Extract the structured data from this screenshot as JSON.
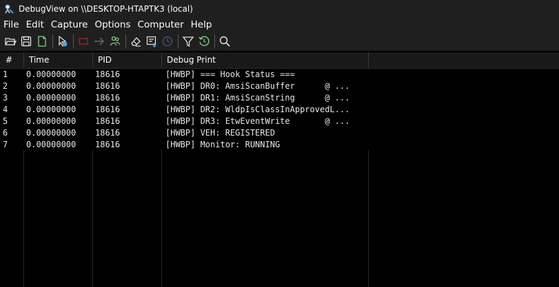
{
  "window": {
    "title": "DebugView on \\\\DESKTOP-HTAPTK3 (local)"
  },
  "menu": [
    "File",
    "Edit",
    "Capture",
    "Options",
    "Computer",
    "Help"
  ],
  "toolbar": {
    "icons": [
      "open-icon",
      "save-icon",
      "new-log-icon",
      "capture-icon",
      "stop-icon",
      "forward-icon",
      "connect-icon",
      "clear-icon",
      "autoscroll-icon",
      "time-icon",
      "filter-icon",
      "history-icon",
      "find-icon"
    ]
  },
  "columns": {
    "num": "#",
    "time": "Time",
    "pid": "PID",
    "debug": "Debug Print"
  },
  "rows": [
    {
      "num": "1",
      "time": "0.00000000",
      "pid": "18616",
      "text": "[HWBP] === Hook Status ==="
    },
    {
      "num": "2",
      "time": "0.00000000",
      "pid": "18616",
      "text": "[HWBP] DR0: AmsiScanBuffer      @ ..."
    },
    {
      "num": "3",
      "time": "0.00000000",
      "pid": "18616",
      "text": "[HWBP] DR1: AmsiScanString      @ ..."
    },
    {
      "num": "4",
      "time": "0.00000000",
      "pid": "18616",
      "text": "[HWBP] DR2: WldpIsClassInApprovedL..."
    },
    {
      "num": "5",
      "time": "0.00000000",
      "pid": "18616",
      "text": "[HWBP] DR3: EtwEventWrite       @ ..."
    },
    {
      "num": "6",
      "time": "0.00000000",
      "pid": "18616",
      "text": "[HWBP] VEH: REGISTERED"
    },
    {
      "num": "7",
      "time": "0.00000000",
      "pid": "18616",
      "text": "[HWBP] Monitor: RUNNING"
    }
  ],
  "colors": {
    "background": "#000000",
    "chrome": "#1f1f1f",
    "accent_blue": "#4aa3e8",
    "accent_green": "#7fd37f",
    "accent_red": "#b03030"
  }
}
